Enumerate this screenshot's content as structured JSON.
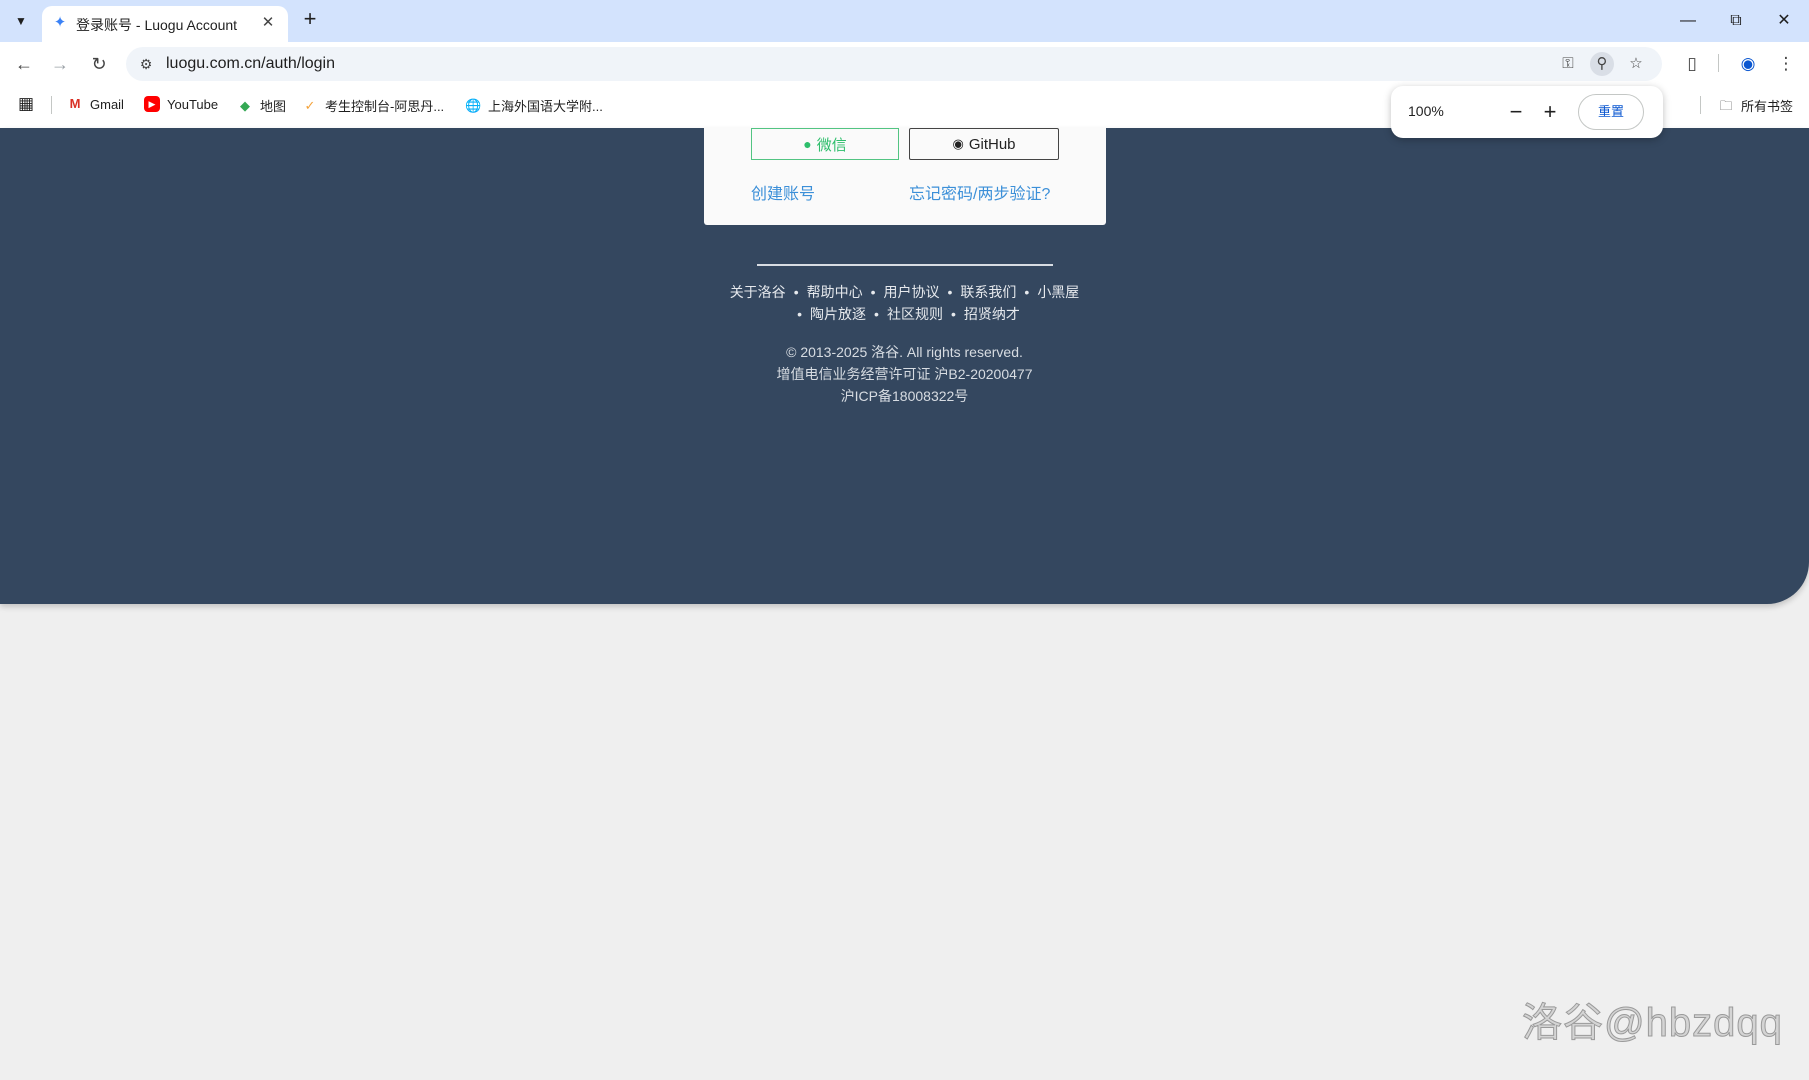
{
  "browser": {
    "tab": {
      "title": "登录账号 - Luogu Account",
      "favicon": "luogu-icon"
    },
    "url": "luogu.com.cn/auth/login",
    "bookmarks": [
      {
        "label": "Gmail",
        "icon": "gmail-icon",
        "color": "#d93025"
      },
      {
        "label": "YouTube",
        "icon": "youtube-icon",
        "color": "#ff0000"
      },
      {
        "label": "地图",
        "icon": "maps-icon",
        "color": "#34a853"
      },
      {
        "label": "考生控制台-阿思丹...",
        "icon": "ap-icon",
        "color": "#f4a23a"
      },
      {
        "label": "上海外国语大学附...",
        "icon": "globe-icon",
        "color": "#5f6368"
      }
    ],
    "all_bookmarks": "所有书签",
    "zoom": {
      "percent": "100%",
      "reset_label": "重置"
    }
  },
  "login_card": {
    "wechat_label": "微信",
    "github_label": "GitHub",
    "create_account": "创建账号",
    "forgot_password": "忘记密码/两步验证?"
  },
  "footer": {
    "links_row1": [
      "关于洛谷",
      "帮助中心",
      "用户协议",
      "联系我们",
      "小黑屋"
    ],
    "links_row2": [
      "陶片放逐",
      "社区规则",
      "招贤纳才"
    ],
    "copyright": "© 2013-2025 洛谷. All rights reserved.",
    "license": "增值电信业务经营许可证 沪B2-20200477",
    "icp": "沪ICP备18008322号"
  },
  "watermark": "洛谷@hbzdqq",
  "colors": {
    "page_bg": "#34475f",
    "wechat_green": "#2dbe6b",
    "link_blue": "#3b8fd8"
  }
}
